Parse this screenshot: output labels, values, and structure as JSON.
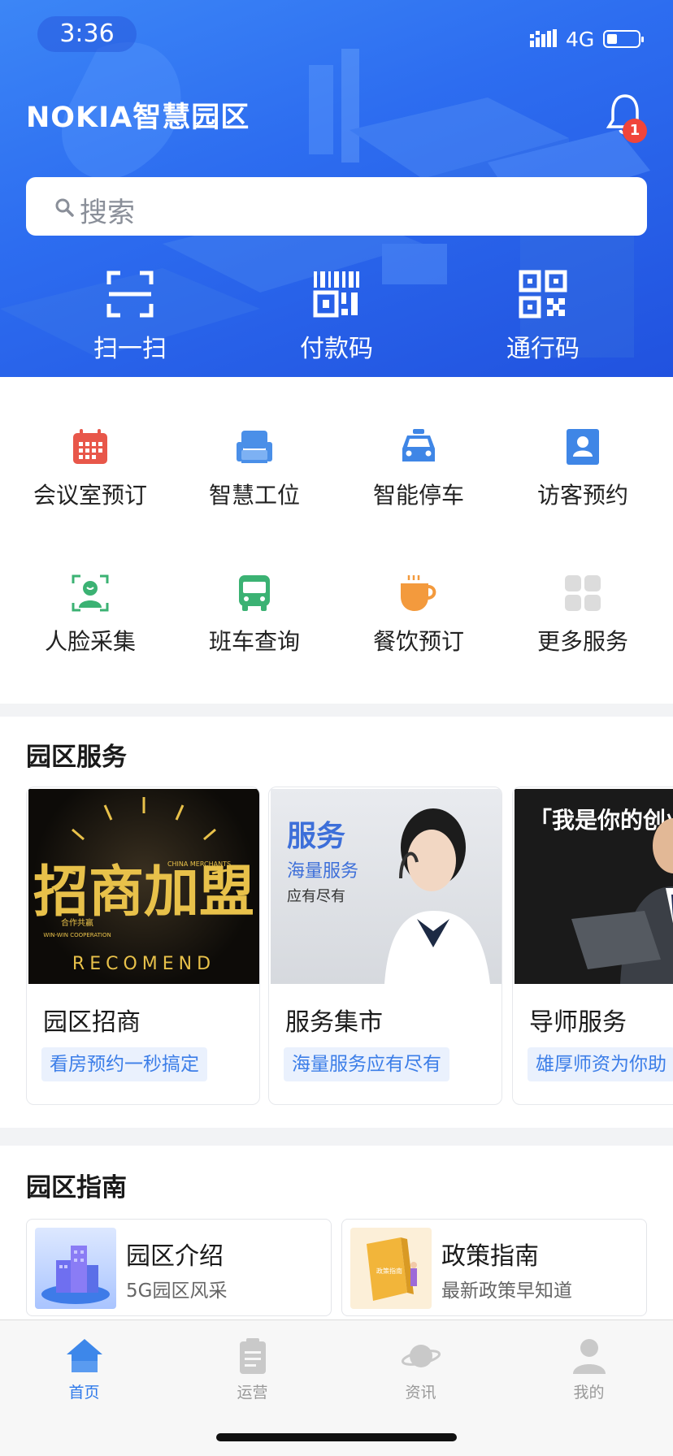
{
  "status_bar": {
    "time": "3:36",
    "network": "4G"
  },
  "header": {
    "brand": "NOKIA智慧园区",
    "notification_count": "1"
  },
  "search": {
    "placeholder": "搜索"
  },
  "hero_actions": [
    {
      "label": "扫一扫",
      "icon": "scan-icon"
    },
    {
      "label": "付款码",
      "icon": "payment-code-icon"
    },
    {
      "label": "通行码",
      "icon": "qr-code-icon"
    }
  ],
  "services": [
    {
      "label": "会议室预订",
      "icon": "calendar-icon",
      "color": "#e8574a"
    },
    {
      "label": "智慧工位",
      "icon": "seat-icon",
      "color": "#4a8fe8"
    },
    {
      "label": "智能停车",
      "icon": "car-icon",
      "color": "#3f86e6"
    },
    {
      "label": "访客预约",
      "icon": "visitor-icon",
      "color": "#3f86e6"
    },
    {
      "label": "人脸采集",
      "icon": "face-scan-icon",
      "color": "#3bb273"
    },
    {
      "label": "班车查询",
      "icon": "bus-icon",
      "color": "#3bb273"
    },
    {
      "label": "餐饮预订",
      "icon": "coffee-cup-icon",
      "color": "#f39a3d"
    },
    {
      "label": "更多服务",
      "icon": "grid-more-icon",
      "color": "#d9d9d9"
    }
  ],
  "park_services": {
    "title": "园区服务",
    "cards": [
      {
        "name": "园区招商",
        "tag": "看房预约一秒搞定",
        "image_text": {
          "main": "招商加盟",
          "sub1": "CHINA MERCHANTS",
          "sub2": "合作共赢",
          "sub3": "WIN-WIN COOPERATION",
          "arc": "RECOMEND"
        }
      },
      {
        "name": "服务集市",
        "tag": "海量服务应有尽有",
        "image_text": {
          "main": "服务",
          "sub1": "海量服务",
          "sub2": "应有尽有"
        }
      },
      {
        "name": "导师服务",
        "tag": "雄厚师资为你助",
        "image_text": {
          "main": "「我是你的创业导师」"
        }
      }
    ]
  },
  "park_guide": {
    "title": "园区指南",
    "items": [
      {
        "title": "园区介绍",
        "subtitle": "5G园区风采"
      },
      {
        "title": "政策指南",
        "subtitle": "最新政策早知道",
        "book_label": "政策指南"
      }
    ]
  },
  "tabbar": [
    {
      "label": "首页",
      "icon": "home-icon",
      "active": true
    },
    {
      "label": "运营",
      "icon": "clipboard-icon",
      "active": false
    },
    {
      "label": "资讯",
      "icon": "planet-icon",
      "active": false
    },
    {
      "label": "我的",
      "icon": "user-icon",
      "active": false
    }
  ],
  "colors": {
    "primary": "#2e79ea",
    "hero_gradient_start": "#3c86f6",
    "hero_gradient_end": "#2152df",
    "badge": "#f0453a"
  }
}
